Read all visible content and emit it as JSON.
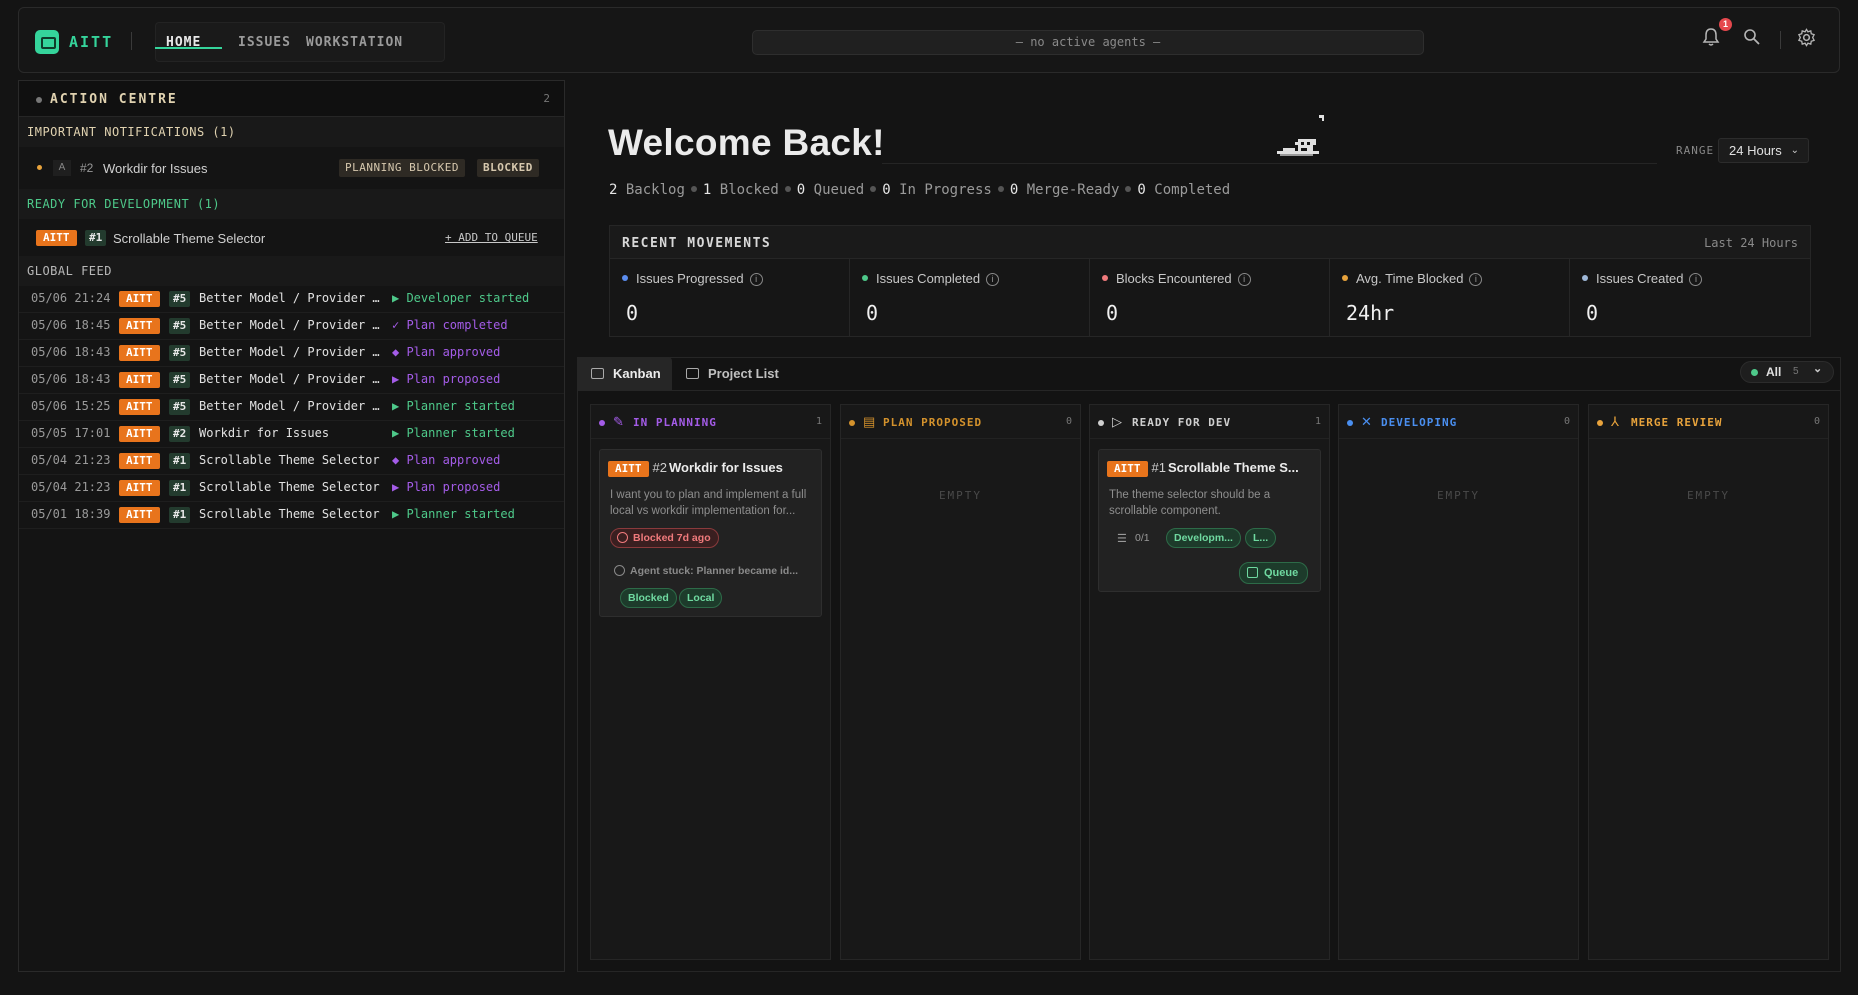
{
  "app": {
    "brand": "AITT",
    "agents_status": "— no active agents —",
    "notification_count": "1"
  },
  "nav": {
    "home": "HOME",
    "issues": "ISSUES",
    "workstation": "WORKSTATION"
  },
  "action_centre": {
    "title": "ACTION CENTRE",
    "count": "2",
    "important": {
      "header": "IMPORTANT NOTIFICATIONS (1)",
      "item": {
        "avatar": "A",
        "num": "#2",
        "title": "Workdir for Issues",
        "badge1": "PLANNING BLOCKED",
        "badge2": "BLOCKED"
      }
    },
    "ready": {
      "header": "READY FOR DEVELOPMENT (1)",
      "item": {
        "project": "AITT",
        "num": "#1",
        "title": "Scrollable Theme Selector",
        "action": "+ ADD TO QUEUE"
      }
    },
    "feed_header": "GLOBAL FEED",
    "feed": [
      {
        "date": "05/06 21:24",
        "project": "AITT",
        "num": "#5",
        "title": "Better Model / Provider Selection",
        "action": "▶ Developer started",
        "tone": "green"
      },
      {
        "date": "05/06 18:45",
        "project": "AITT",
        "num": "#5",
        "title": "Better Model / Provider Selection",
        "action": "✓ Plan completed",
        "tone": "purple"
      },
      {
        "date": "05/06 18:43",
        "project": "AITT",
        "num": "#5",
        "title": "Better Model / Provider Selection",
        "action": "◆ Plan approved",
        "tone": "purple"
      },
      {
        "date": "05/06 18:43",
        "project": "AITT",
        "num": "#5",
        "title": "Better Model / Provider Selection",
        "action": "▶ Plan proposed",
        "tone": "purple"
      },
      {
        "date": "05/06 15:25",
        "project": "AITT",
        "num": "#5",
        "title": "Better Model / Provider Selection",
        "action": "▶ Planner started",
        "tone": "green"
      },
      {
        "date": "05/05 17:01",
        "project": "AITT",
        "num": "#2",
        "title": "Workdir for Issues",
        "action": "▶ Planner started",
        "tone": "green"
      },
      {
        "date": "05/04 21:23",
        "project": "AITT",
        "num": "#1",
        "title": "Scrollable Theme Selector",
        "action": "◆ Plan approved",
        "tone": "purple"
      },
      {
        "date": "05/04 21:23",
        "project": "AITT",
        "num": "#1",
        "title": "Scrollable Theme Selector",
        "action": "▶ Plan proposed",
        "tone": "purple"
      },
      {
        "date": "05/01 18:39",
        "project": "AITT",
        "num": "#1",
        "title": "Scrollable Theme Selector",
        "action": "▶ Planner started",
        "tone": "green"
      }
    ]
  },
  "main": {
    "welcome": "Welcome Back!",
    "range_label": "RANGE",
    "range_value": "24 Hours",
    "summary": [
      {
        "value": "2",
        "label": "Backlog"
      },
      {
        "value": "1",
        "label": "Blocked"
      },
      {
        "value": "0",
        "label": "Queued"
      },
      {
        "value": "0",
        "label": "In Progress"
      },
      {
        "value": "0",
        "label": "Merge-Ready"
      },
      {
        "value": "0",
        "label": "Completed"
      }
    ],
    "movements": {
      "title": "RECENT MOVEMENTS",
      "range": "Last 24 Hours",
      "stats": [
        {
          "label": "Issues Progressed",
          "value": "0",
          "color": "#5b8def"
        },
        {
          "label": "Issues Completed",
          "value": "0",
          "color": "#4ec98a"
        },
        {
          "label": "Blocks Encountered",
          "value": "0",
          "color": "#f07a7c"
        },
        {
          "label": "Avg. Time Blocked",
          "value": "24hr",
          "color": "#e8a33c"
        },
        {
          "label": "Issues Created",
          "value": "0",
          "color": "#9fb8d8"
        }
      ]
    },
    "tabs": {
      "kanban": "Kanban",
      "project_list": "Project List",
      "filter": "All",
      "filter_count": "5"
    },
    "columns": [
      {
        "title": "IN PLANNING",
        "count": "1",
        "color": "#a45ce8",
        "icon": "✎"
      },
      {
        "title": "PLAN PROPOSED",
        "count": "0",
        "color": "#d4922c",
        "icon": "▤"
      },
      {
        "title": "READY FOR DEV",
        "count": "1",
        "color": "#cfcfcf",
        "icon": "▷"
      },
      {
        "title": "DEVELOPING",
        "count": "0",
        "color": "#4a8ff0",
        "icon": "✕"
      },
      {
        "title": "MERGE REVIEW",
        "count": "0",
        "color": "#e8a33c",
        "icon": "⅄"
      }
    ],
    "empty_label": "EMPTY",
    "card_planning": {
      "project": "AITT",
      "num": "#2",
      "title": "Workdir for Issues",
      "desc": "I want you to plan and implement a full local vs workdir implementation for...",
      "blocked": "Blocked 7d ago",
      "stuck": "Agent stuck: Planner became id...",
      "chip1": "Blocked",
      "chip2": "Local"
    },
    "card_ready": {
      "project": "AITT",
      "num": "#1",
      "title": "Scrollable Theme S...",
      "desc": "The theme selector should be a scrollable component.",
      "tasks": "0/1",
      "chip1": "Developm...",
      "chip2": "L...",
      "queue": "Queue"
    }
  }
}
